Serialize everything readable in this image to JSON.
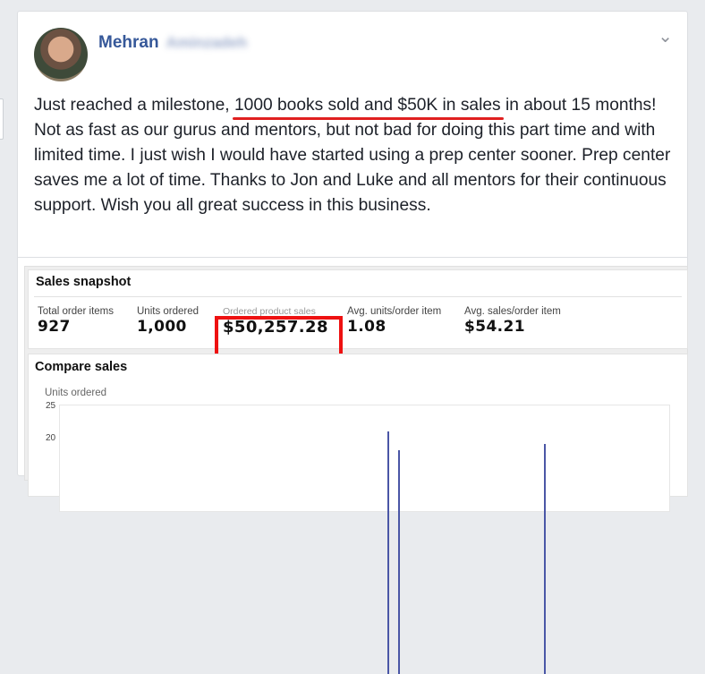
{
  "post": {
    "author_first": "Mehran",
    "author_last": "Aminzadeh",
    "text_before": "Just reached a milestone, ",
    "text_highlight": "1000 books sold and $50K in sales",
    "text_after": " in about 15 months! Not as fast as our gurus and mentors, but not bad for doing this part time and with limited time. I just wish I would have started using a prep center sooner. Prep center saves me a lot of time. Thanks to Jon and Luke and all mentors for their continuous support. Wish you all great success in this business."
  },
  "snapshot": {
    "title": "Sales snapshot",
    "metrics": [
      {
        "label": "Total order items",
        "value": "927"
      },
      {
        "label": "Units ordered",
        "value": "1,000"
      },
      {
        "label": "Ordered product sales",
        "value": "$50,257.28"
      },
      {
        "label": "Avg. units/order item",
        "value": "1.08"
      },
      {
        "label": "Avg. sales/order item",
        "value": "$54.21"
      }
    ]
  },
  "compare": {
    "title": "Compare sales",
    "y_label": "Units ordered",
    "ticks": [
      "25",
      "20"
    ]
  },
  "chart_data": {
    "type": "bar",
    "title": "Compare sales",
    "ylabel": "Units ordered",
    "ylim": [
      0,
      25
    ],
    "values_visible": [
      21,
      18,
      19
    ]
  },
  "colors": {
    "link": "#365899",
    "annotation_red": "#ee1111",
    "series": "#4a56a6"
  },
  "icons": {
    "options": "chevron-down-icon"
  }
}
